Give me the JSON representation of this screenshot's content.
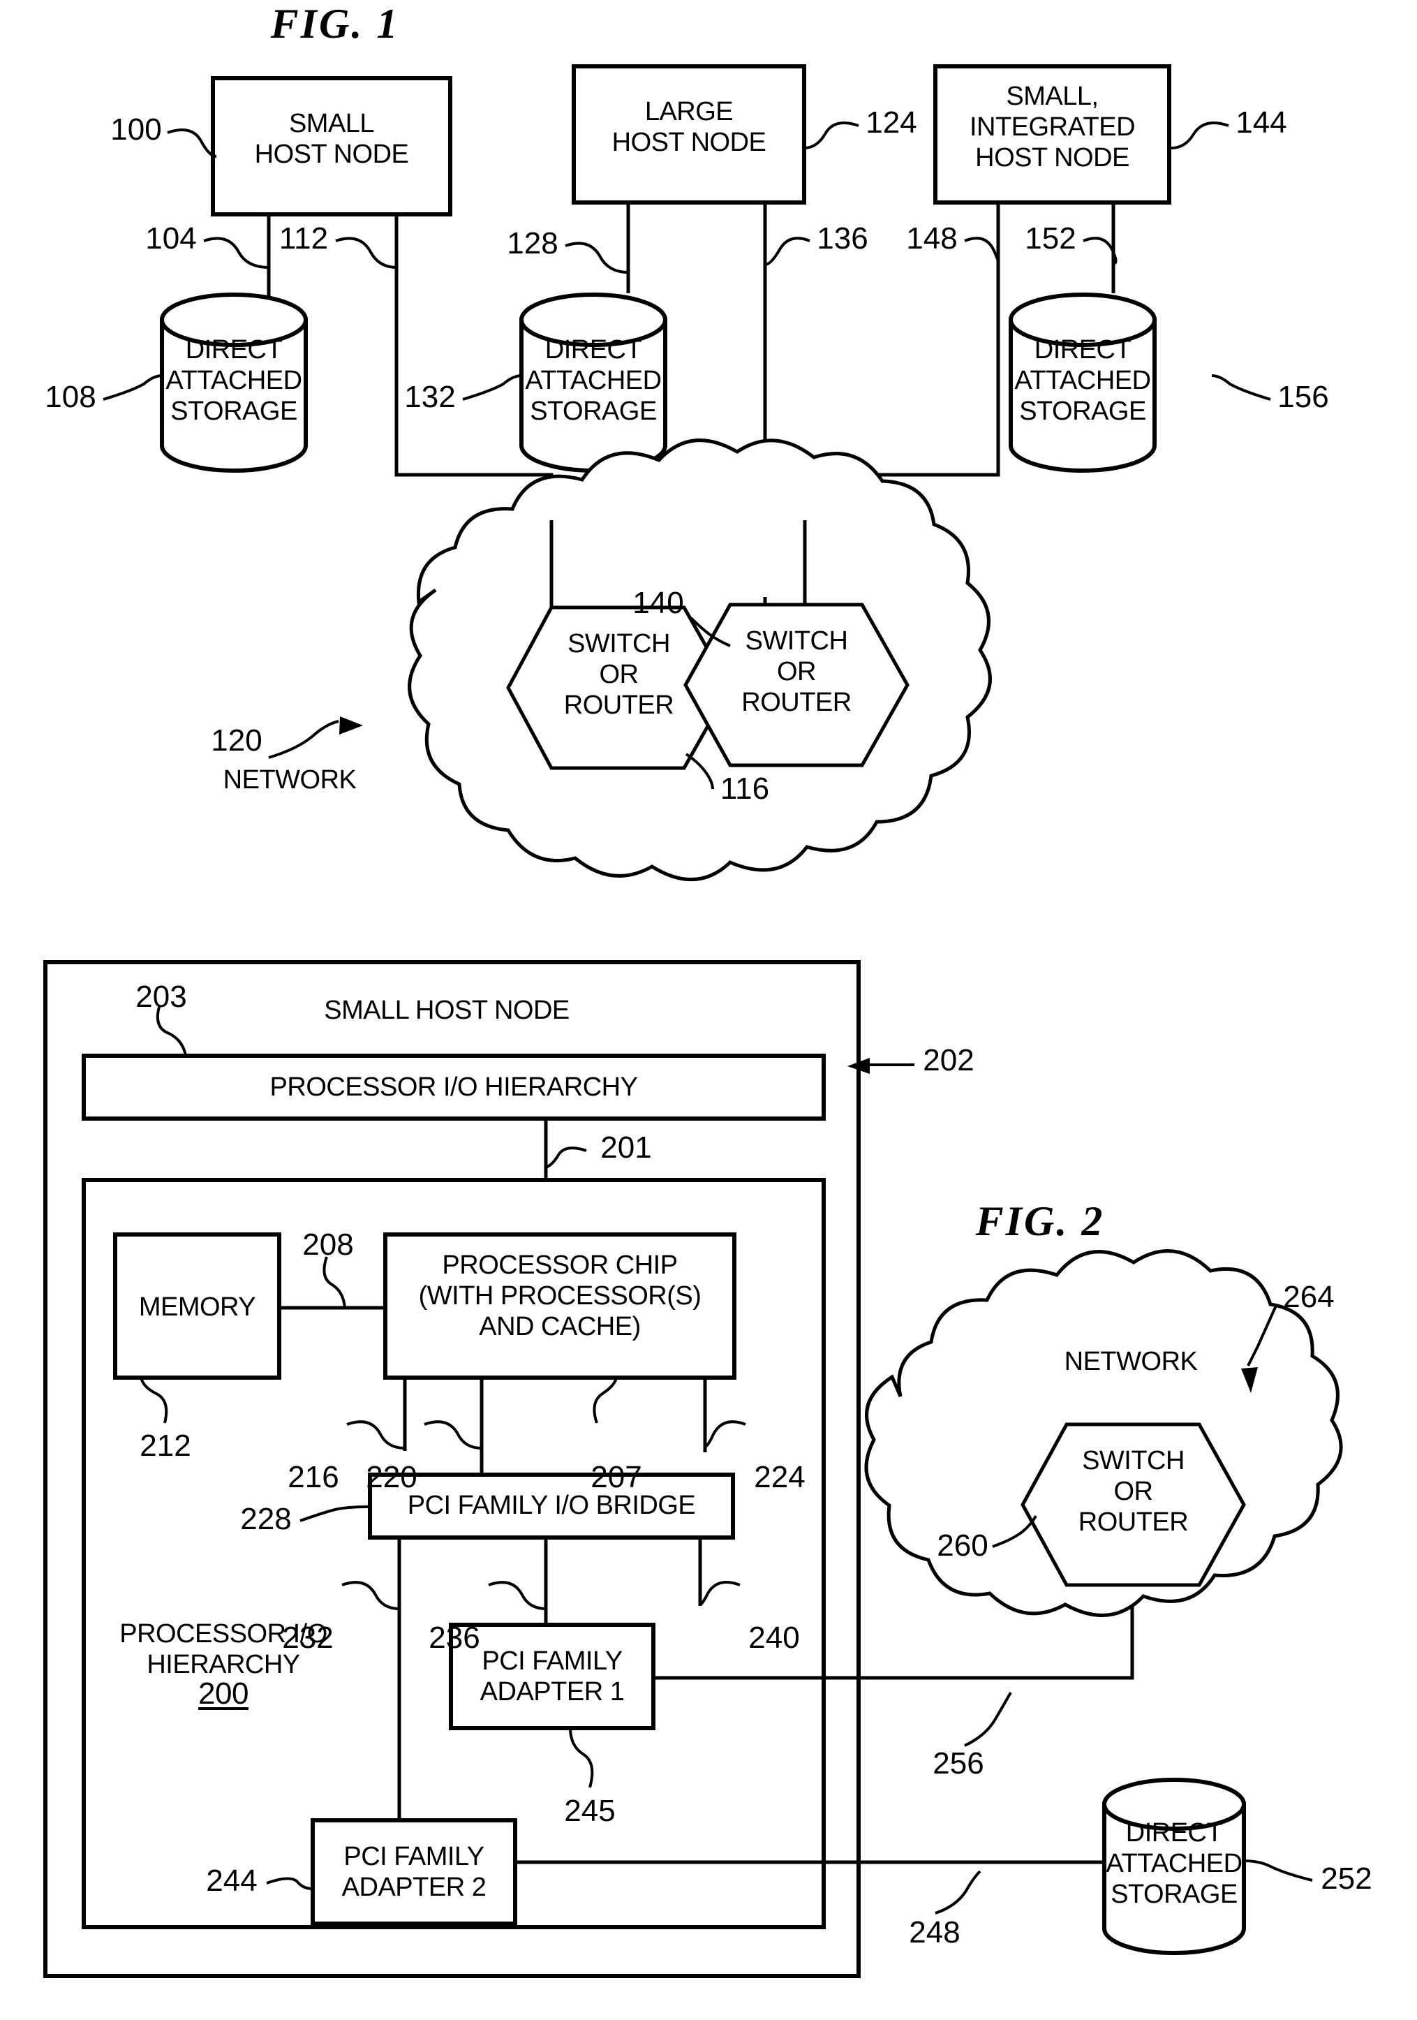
{
  "figures": {
    "fig1": {
      "title": "FIG. 1",
      "nodes": {
        "small_host": "SMALL\nHOST NODE",
        "large_host": "LARGE\nHOST NODE",
        "small_integrated_host": "SMALL,\nINTEGRATED\nHOST NODE",
        "das_1": "DIRECT\nATTACHED\nSTORAGE",
        "das_2": "DIRECT\nATTACHED\nSTORAGE",
        "das_3": "DIRECT\nATTACHED\nSTORAGE",
        "switch_left": "SWITCH\nOR\nROUTER",
        "switch_right": "SWITCH\nOR\nROUTER",
        "network_label": "NETWORK"
      },
      "refs": {
        "r100": "100",
        "r104": "104",
        "r108": "108",
        "r112": "112",
        "r116": "116",
        "r120": "120",
        "r124": "124",
        "r128": "128",
        "r132": "132",
        "r136": "136",
        "r140": "140",
        "r144": "144",
        "r148": "148",
        "r152": "152",
        "r156": "156"
      }
    },
    "fig2": {
      "title": "FIG. 2",
      "nodes": {
        "small_host_node": "SMALL HOST NODE",
        "processor_io_hierarchy_bar": "PROCESSOR I/O HIERARCHY",
        "memory": "MEMORY",
        "processor_chip": "PROCESSOR CHIP\n(WITH PROCESSOR(S)\nAND CACHE)",
        "pci_bridge": "PCI FAMILY I/O BRIDGE",
        "pci_adapter_1": "PCI FAMILY\nADAPTER 1",
        "pci_adapter_2": "PCI FAMILY\nADAPTER 2",
        "hierarchy_caption": "PROCESSOR I/O\nHIERARCHY",
        "hierarchy_number": "200",
        "network_label": "NETWORK",
        "switch_or_router": "SWITCH\nOR\nROUTER",
        "das": "DIRECT\nATTACHED\nSTORAGE"
      },
      "refs": {
        "r201": "201",
        "r202": "202",
        "r203": "203",
        "r207": "207",
        "r208": "208",
        "r212": "212",
        "r216": "216",
        "r220": "220",
        "r224": "224",
        "r228": "228",
        "r232": "232",
        "r236": "236",
        "r240": "240",
        "r244": "244",
        "r245": "245",
        "r248": "248",
        "r252": "252",
        "r256": "256",
        "r260": "260",
        "r264": "264"
      }
    }
  },
  "colors": {
    "ink": "#000000",
    "paper": "#ffffff"
  }
}
